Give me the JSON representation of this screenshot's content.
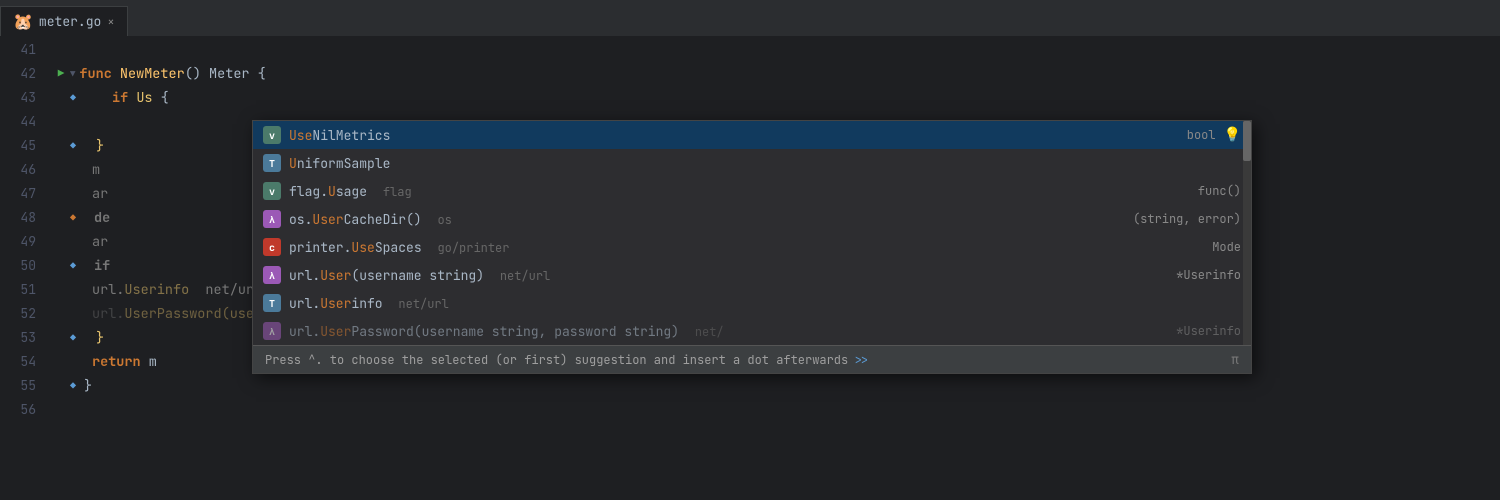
{
  "tab": {
    "title": "meter.go",
    "icon": "🐹",
    "close": "×"
  },
  "lines": [
    {
      "num": 41,
      "fold": "",
      "content": ""
    },
    {
      "num": 42,
      "fold": "open",
      "content": "func_NewMeter",
      "hasArrow": true
    },
    {
      "num": 43,
      "fold": "bookmark",
      "content": "if_Us"
    },
    {
      "num": 44,
      "fold": "",
      "content": ""
    },
    {
      "num": 45,
      "fold": "bookmark",
      "content": "close_brace"
    },
    {
      "num": 46,
      "fold": "",
      "content": "m_line"
    },
    {
      "num": 47,
      "fold": "",
      "content": "ar_line"
    },
    {
      "num": 48,
      "fold": "",
      "content": "de_line"
    },
    {
      "num": 49,
      "fold": "",
      "content": "ar_line2"
    },
    {
      "num": 50,
      "fold": "bookmark",
      "content": "if_line"
    },
    {
      "num": 51,
      "fold": "",
      "content": "url_line"
    },
    {
      "num": 52,
      "fold": "",
      "content": "url_line2"
    },
    {
      "num": 53,
      "fold": "bookmark",
      "content": "close_brace2"
    },
    {
      "num": 54,
      "fold": "",
      "content": "return_m"
    },
    {
      "num": 55,
      "fold": "bookmark",
      "content": "close_brace3"
    },
    {
      "num": 56,
      "fold": "",
      "content": ""
    }
  ],
  "autocomplete": {
    "items": [
      {
        "badge": "v",
        "badgeClass": "badge-v",
        "name": "UseNilMetrics",
        "nameHighlight": "Us",
        "source": "",
        "type": "bool",
        "hasBulb": true,
        "selected": true
      },
      {
        "badge": "T",
        "badgeClass": "badge-t",
        "name": "UniformSample",
        "nameHighlight": "U",
        "source": "",
        "type": "",
        "hasBulb": false,
        "selected": false
      },
      {
        "badge": "v",
        "badgeClass": "badge-v",
        "name": "flag.Usage",
        "nameHighlight": "U",
        "source": "flag",
        "type": "func()",
        "hasBulb": false,
        "selected": false
      },
      {
        "badge": "λ",
        "badgeClass": "badge-lambda",
        "name": "os.UserCacheDir()",
        "nameHighlight": "User",
        "source": "os",
        "type": "(string, error)",
        "hasBulb": false,
        "selected": false
      },
      {
        "badge": "c",
        "badgeClass": "badge-c",
        "name": "printer.UseSpaces",
        "nameHighlight": "Use",
        "source": "go/printer",
        "type": "Mode",
        "hasBulb": false,
        "selected": false
      },
      {
        "badge": "λ",
        "badgeClass": "badge-lambda",
        "name": "url.User(username string)",
        "nameHighlight": "User",
        "source": "net/url",
        "type": "*Userinfo",
        "hasBulb": false,
        "selected": false
      },
      {
        "badge": "T",
        "badgeClass": "badge-t",
        "name": "url.Userinfo",
        "nameHighlight": "User",
        "source": "net/url",
        "type": "",
        "hasBulb": false,
        "selected": false
      },
      {
        "badge": "λ",
        "badgeClass": "badge-lambda",
        "name": "url.UserPassword(username string,  password string)",
        "nameHighlight": "User",
        "source": "net/",
        "type": "*Userinfo",
        "hasBulb": false,
        "selected": false,
        "dimmed": true
      }
    ],
    "status": {
      "text": "Press ^. to choose the selected (or first) suggestion and insert a dot afterwards",
      "link": ">>",
      "pi": "π"
    }
  }
}
